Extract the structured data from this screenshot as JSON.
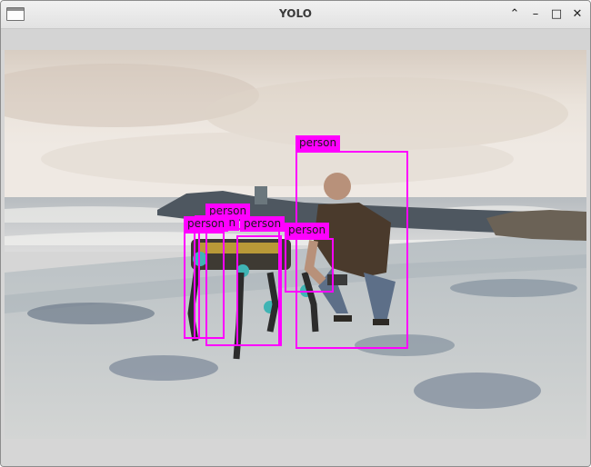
{
  "window": {
    "title": "YOLO",
    "controls": {
      "shade": "⌃",
      "minimize": "–",
      "maximize": "□",
      "close": "✕"
    }
  },
  "image": {
    "description_icon": "photo",
    "detections": [
      {
        "label": "person"
      },
      {
        "label": "person"
      },
      {
        "label": "person"
      },
      {
        "label": "person"
      },
      {
        "label": "person"
      },
      {
        "label": "person"
      }
    ]
  },
  "colors": {
    "box": "#ff00ff",
    "sky": "#e6ddd3",
    "sand": "#c7ccd0"
  }
}
